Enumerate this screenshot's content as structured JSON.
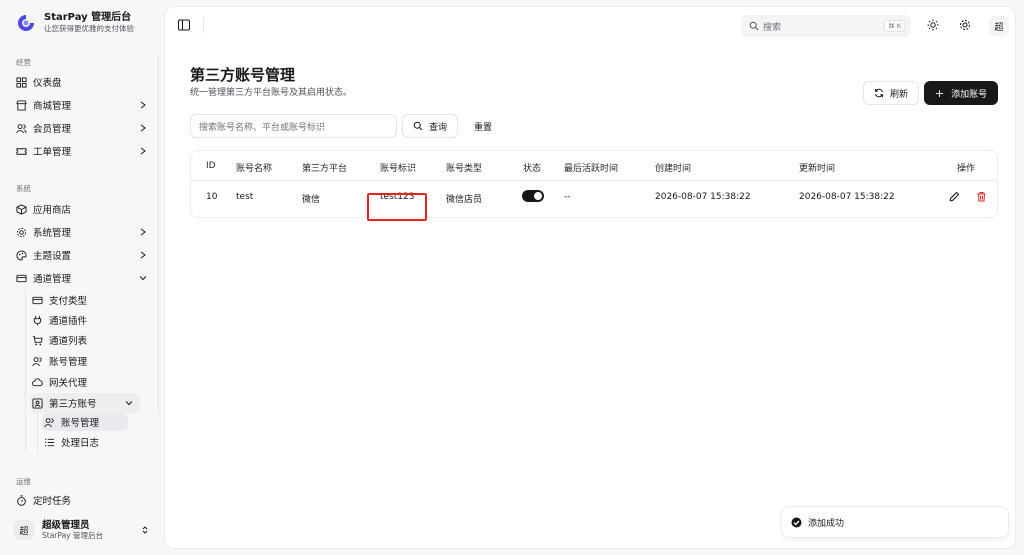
{
  "brand": {
    "name": "StarPay 管理后台",
    "subtitle": "让您获得更优雅的支付体验"
  },
  "sidebar": {
    "groups": [
      {
        "label": "经营",
        "items": [
          {
            "label": "仪表盘",
            "icon": "dashboard-icon"
          },
          {
            "label": "商城管理",
            "icon": "store-icon"
          },
          {
            "label": "会员管理",
            "icon": "users-icon"
          },
          {
            "label": "工单管理",
            "icon": "ticket-icon"
          }
        ]
      },
      {
        "label": "系统",
        "items": [
          {
            "label": "应用商店",
            "icon": "package-icon"
          },
          {
            "label": "系统管理",
            "icon": "gear-icon"
          },
          {
            "label": "主题设置",
            "icon": "palette-icon"
          },
          {
            "label": "通道管理",
            "icon": "card-icon"
          }
        ]
      },
      {
        "label": "运维",
        "items": [
          {
            "label": "定时任务",
            "icon": "timer-icon"
          }
        ]
      }
    ],
    "channel_sub": [
      {
        "label": "支付类型",
        "icon": "card-icon"
      },
      {
        "label": "通道插件",
        "icon": "plug-icon"
      },
      {
        "label": "通道列表",
        "icon": "cart-icon"
      },
      {
        "label": "账号管理",
        "icon": "users-icon"
      },
      {
        "label": "网关代理",
        "icon": "cloud-icon"
      },
      {
        "label": "第三方账号",
        "icon": "contact-icon"
      }
    ],
    "third_party_sub": [
      {
        "label": "账号管理",
        "icon": "users-icon",
        "active": true
      },
      {
        "label": "处理日志",
        "icon": "list-icon"
      }
    ]
  },
  "user": {
    "avatar": "超",
    "name": "超级管理员",
    "subtitle": "StarPay 管理后台"
  },
  "topbar": {
    "search_placeholder": "搜索",
    "shortcut": "⌘ K",
    "avatar": "超"
  },
  "page": {
    "title": "第三方账号管理",
    "subtitle": "统一管理第三方平台账号及其启用状态。",
    "refresh_label": "刷新",
    "add_label": "添加账号"
  },
  "filters": {
    "search_placeholder": "搜索账号名称、平台或账号标识",
    "query_label": "查询",
    "reset_label": "重置"
  },
  "table": {
    "columns": [
      "ID",
      "账号名称",
      "第三方平台",
      "账号标识",
      "账号类型",
      "状态",
      "最后活跃时间",
      "创建时间",
      "更新时间",
      "操作"
    ],
    "rows": [
      {
        "id": "10",
        "name": "test",
        "platform": "微信",
        "identifier": "test123",
        "type": "微信店员",
        "enabled": true,
        "last_active": "--",
        "created": "2026-08-07 15:38:22",
        "updated": "2026-08-07 15:38:22"
      }
    ]
  },
  "toast": {
    "message": "添加成功"
  },
  "colors": {
    "primary": "#18181b",
    "danger": "#e0261f",
    "highlight": "#e0261f"
  }
}
